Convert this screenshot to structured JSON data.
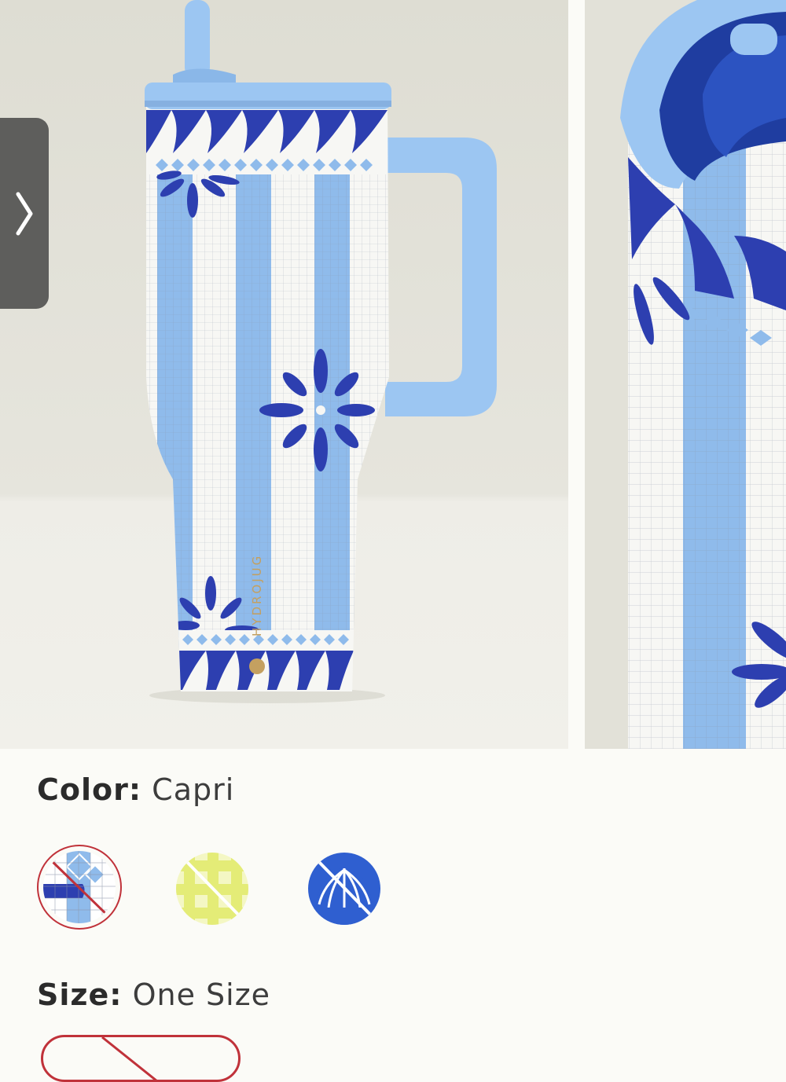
{
  "gallery": {
    "main_image_alt": "",
    "next_arrow_icon": "chevron-right-icon",
    "brand_mark": "HYDROJUG",
    "colors": {
      "tumbler_light_blue": "#8fbbeb",
      "tile_dark_blue": "#2d3fb0",
      "lid_blue": "#9cc6f2",
      "background": "#e9e8e0"
    }
  },
  "product": {
    "color_label": "Color:",
    "color_value": "Capri",
    "size_label": "Size:",
    "size_value": "One Size"
  },
  "swatches": [
    {
      "name": "Capri",
      "selected": true,
      "unavailable": true,
      "icon": "mosaic-tile-swatch-icon"
    },
    {
      "name": "",
      "selected": false,
      "unavailable": true,
      "icon": "yellow-gingham-swatch-icon"
    },
    {
      "name": "",
      "selected": false,
      "unavailable": true,
      "icon": "blue-shell-swatch-icon"
    }
  ],
  "accent": {
    "selected_border": "#c0323a",
    "strike_line": "#ffffff"
  }
}
